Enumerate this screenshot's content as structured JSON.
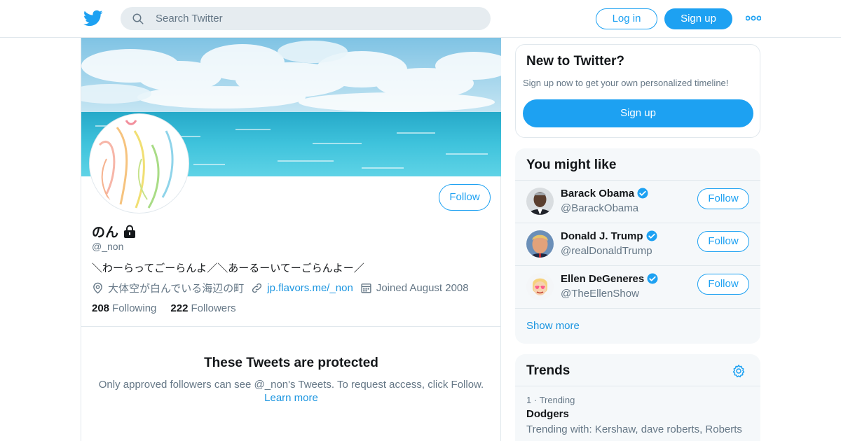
{
  "header": {
    "search_placeholder": "Search Twitter",
    "login_label": "Log in",
    "signup_label": "Sign up",
    "icons": [
      "twitter-bird-icon",
      "search-icon",
      "more-icon"
    ]
  },
  "profile": {
    "display_name": "のん",
    "handle": "@_non",
    "bio": "＼わーらってごーらんよ／＼あーるーいてーごらんよー／",
    "location": "大体空が白んでいる海辺の町",
    "website": "jp.flavors.me/_non",
    "joined": "Joined August 2008",
    "following_count": "208",
    "following_label": "Following",
    "followers_count": "222",
    "followers_label": "Followers",
    "follow_label": "Follow",
    "protected_title": "These Tweets are protected",
    "protected_desc": "Only approved followers can see @_non's Tweets. To request access, click Follow.",
    "learn_more": "Learn more",
    "icons": [
      "lock-icon",
      "location-icon",
      "link-icon",
      "calendar-icon"
    ]
  },
  "new_to_twitter": {
    "title": "New to Twitter?",
    "desc": "Sign up now to get your own personalized timeline!",
    "button": "Sign up"
  },
  "you_might_like": {
    "title": "You might like",
    "items": [
      {
        "name": "Barack Obama",
        "handle": "@BarackObama",
        "follow": "Follow",
        "verified": true
      },
      {
        "name": "Donald J. Trump",
        "handle": "@realDonaldTrump",
        "follow": "Follow",
        "verified": true
      },
      {
        "name": "Ellen DeGeneres",
        "handle": "@TheEllenShow",
        "follow": "Follow",
        "verified": true
      }
    ],
    "show_more": "Show more"
  },
  "trends": {
    "title": "Trends",
    "items": [
      {
        "rank": "1",
        "meta": "Trending",
        "name": "Dodgers",
        "with": "Trending with: Kershaw, dave roberts, Roberts"
      }
    ]
  },
  "colors": {
    "accent": "#1da1f2",
    "link": "#1b95e0",
    "secondary_text": "#657786",
    "border": "#e1e8ed",
    "card_bg": "#f5f8fa"
  }
}
